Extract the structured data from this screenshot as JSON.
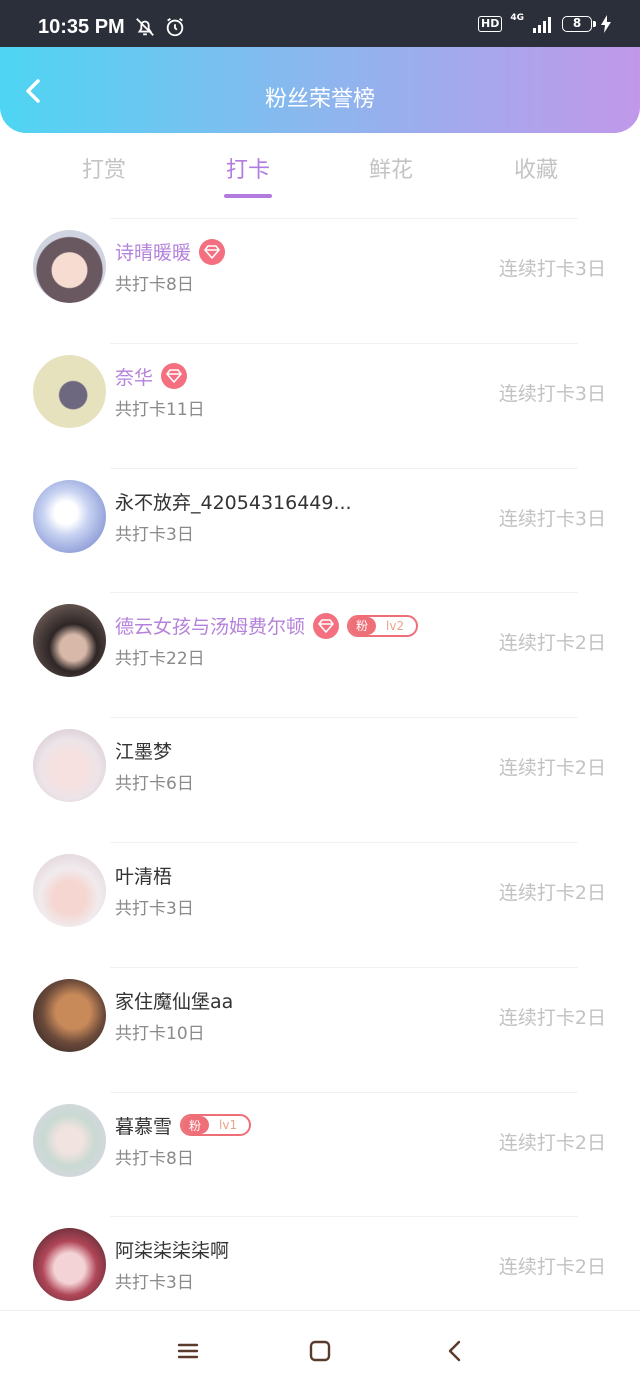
{
  "status_bar": {
    "time": "10:35 PM",
    "hd": "HD",
    "network": "4G",
    "battery": "8",
    "icons": [
      "bell-off-icon",
      "alarm-icon",
      "signal-icon",
      "charging-icon"
    ]
  },
  "header": {
    "title": "粉丝荣誉榜",
    "back_icon": "chevron-left-icon",
    "gradient": [
      "#4ed5f3",
      "#c198ea"
    ]
  },
  "tabs": [
    {
      "label": "打赏",
      "active": false
    },
    {
      "label": "打卡",
      "active": true
    },
    {
      "label": "鲜花",
      "active": false
    },
    {
      "label": "收藏",
      "active": false
    }
  ],
  "colors": {
    "accent": "#b17be0",
    "vip_name": "#b582db",
    "badge": "#ef6f78"
  },
  "list": [
    {
      "name": "诗晴暖暖",
      "vip": true,
      "diamond": true,
      "fan_badge": null,
      "total": "共打卡8日",
      "streak": "连续打卡3日"
    },
    {
      "name": "奈华",
      "vip": true,
      "diamond": true,
      "fan_badge": null,
      "total": "共打卡11日",
      "streak": "连续打卡3日"
    },
    {
      "name": "永不放弃_42054316449...",
      "vip": false,
      "diamond": false,
      "fan_badge": null,
      "total": "共打卡3日",
      "streak": "连续打卡3日"
    },
    {
      "name": "德云女孩与汤姆费尔顿",
      "vip": true,
      "diamond": true,
      "fan_badge": {
        "label": "粉",
        "level": "lv2"
      },
      "total": "共打卡22日",
      "streak": "连续打卡2日"
    },
    {
      "name": "江墨梦",
      "vip": false,
      "diamond": false,
      "fan_badge": null,
      "total": "共打卡6日",
      "streak": "连续打卡2日"
    },
    {
      "name": "叶清梧",
      "vip": false,
      "diamond": false,
      "fan_badge": null,
      "total": "共打卡3日",
      "streak": "连续打卡2日"
    },
    {
      "name": "家住魔仙堡aa",
      "vip": false,
      "diamond": false,
      "fan_badge": null,
      "total": "共打卡10日",
      "streak": "连续打卡2日"
    },
    {
      "name": "暮慕雪",
      "vip": false,
      "diamond": false,
      "fan_badge": {
        "label": "粉",
        "level": "lv1"
      },
      "total": "共打卡8日",
      "streak": "连续打卡2日"
    },
    {
      "name": "阿柒柒柒柒啊",
      "vip": false,
      "diamond": false,
      "fan_badge": null,
      "total": "共打卡3日",
      "streak": "连续打卡2日"
    }
  ],
  "nav_bar": {
    "icons": [
      "menu-icon",
      "home-square-icon",
      "back-triangle-icon"
    ]
  }
}
